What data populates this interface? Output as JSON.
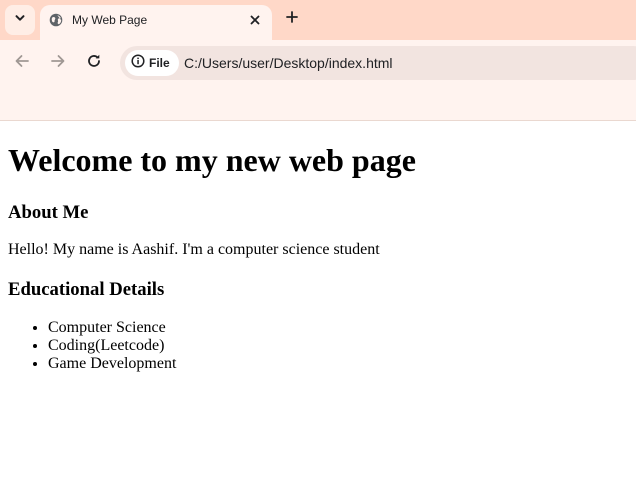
{
  "browser": {
    "tab": {
      "title": "My Web Page"
    },
    "omnibox": {
      "chip_label": "File",
      "url": "C:/Users/user/Desktop/index.html"
    },
    "colors": {
      "tabstrip_bg": "#ffd8c8",
      "toolbar_bg": "#fff3ef",
      "omnibox_bg": "#f2e4e0"
    }
  },
  "page": {
    "heading": "Welcome to my new web page",
    "about_heading": "About Me",
    "about_text": "Hello! My name is Aashif. I'm a computer science student",
    "education_heading": "Educational Details",
    "education_items": [
      "Computer Science",
      "Coding(Leetcode)",
      "Game Development"
    ]
  }
}
